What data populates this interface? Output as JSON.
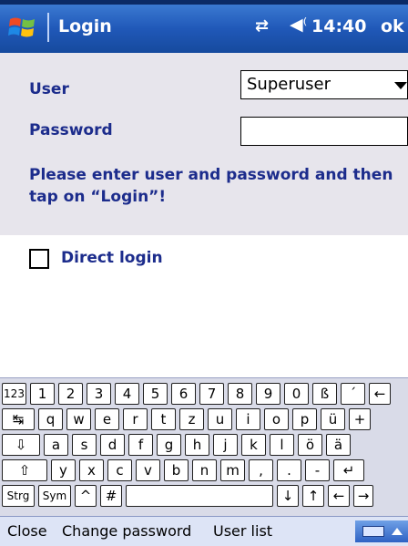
{
  "titlebar": {
    "app_title": "Login",
    "time": "14:40",
    "ok_label": "ok",
    "icons": [
      "windows-start-icon",
      "sync-icon",
      "speaker-icon"
    ]
  },
  "form": {
    "user_label": "User",
    "user_value": "Superuser",
    "password_label": "Password",
    "password_value": "",
    "message": "Please enter user and password and then tap on “Login”!",
    "direct_login_label": "Direct login",
    "direct_login_checked": false
  },
  "keyboard": {
    "row1": [
      "123",
      "1",
      "2",
      "3",
      "4",
      "5",
      "6",
      "7",
      "8",
      "9",
      "0",
      "ß",
      "´",
      "←"
    ],
    "row2": [
      "↹",
      "q",
      "w",
      "e",
      "r",
      "t",
      "z",
      "u",
      "i",
      "o",
      "p",
      "ü",
      "+"
    ],
    "row3": [
      "⇩",
      "a",
      "s",
      "d",
      "f",
      "g",
      "h",
      "j",
      "k",
      "l",
      "ö",
      "ä"
    ],
    "row4": [
      "⇧",
      "y",
      "x",
      "c",
      "v",
      "b",
      "n",
      "m",
      ",",
      ".",
      "-",
      "↵"
    ],
    "row5": [
      "Strg",
      "Sym",
      "^",
      "#",
      "",
      "↓",
      "↑",
      "←",
      "→"
    ]
  },
  "menubar": {
    "close": "Close",
    "change_password": "Change password",
    "user_list": "User list"
  },
  "colors": {
    "title_bar": "#2058b8",
    "label_text": "#1c2c8c",
    "form_bg": "#e7e5ec"
  }
}
